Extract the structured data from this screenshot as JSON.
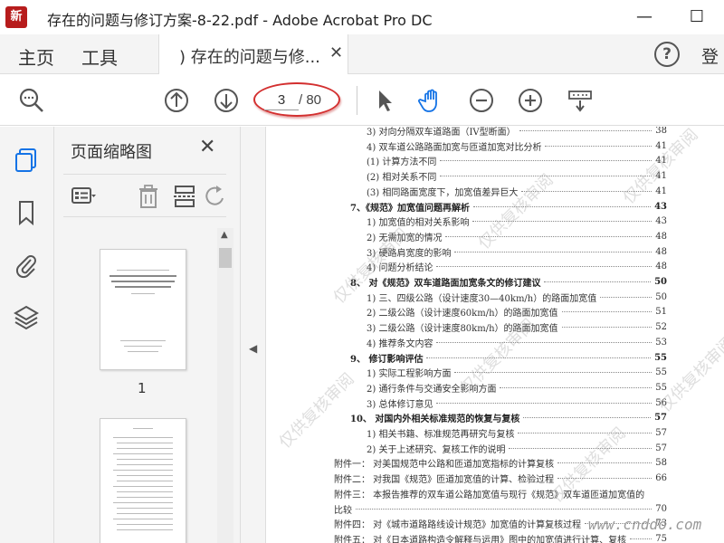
{
  "titlebar": {
    "window_title": "存在的问题与修订方案-8-22.pdf - Adobe Acrobat Pro DC",
    "logo_text": "新",
    "logo_overlay": "新",
    "minimize": "—",
    "maximize": "☐"
  },
  "tabs": {
    "home": "主页",
    "tools": "工具",
    "doc_tab": ") 存在的问题与修...",
    "doc_tab_close": "✕",
    "help": "?",
    "login": "登"
  },
  "toolbar": {
    "page_current": "3",
    "page_total": "/ 80"
  },
  "panel": {
    "title": "页面缩略图",
    "close": "✕",
    "thumb1_number": "1"
  },
  "toc": [
    {
      "text": "3) 对向分隔双车道路面（IV型断面）",
      "page": "38",
      "indent": 3,
      "bold": false
    },
    {
      "text": "4) 双车道公路路面加宽与匝道加宽对比分析",
      "page": "41",
      "indent": 3,
      "bold": false
    },
    {
      "text": "(1) 计算方法不同",
      "page": "41",
      "indent": 3,
      "bold": false
    },
    {
      "text": "(2) 相对关系不同",
      "page": "41",
      "indent": 3,
      "bold": false
    },
    {
      "text": "(3) 相同路面宽度下，加宽值差异巨大",
      "page": "41",
      "indent": 3,
      "bold": false
    },
    {
      "text": "7、《规范》加宽值问题再解析",
      "page": "43",
      "indent": 1,
      "bold": true
    },
    {
      "text": "1) 加宽值的相对关系影响",
      "page": "43",
      "indent": 3,
      "bold": false
    },
    {
      "text": "2) 无需加宽的情况",
      "page": "48",
      "indent": 3,
      "bold": false
    },
    {
      "text": "3) 硬路肩宽度的影响",
      "page": "48",
      "indent": 3,
      "bold": false
    },
    {
      "text": "4) 问题分析结论",
      "page": "48",
      "indent": 3,
      "bold": false
    },
    {
      "text": "8、 对《规范》双车道路面加宽条文的修订建议",
      "page": "50",
      "indent": 1,
      "bold": true
    },
    {
      "text": "1) 三、四级公路（设计速度30—40km/h）的路面加宽值",
      "page": "50",
      "indent": 3,
      "bold": false
    },
    {
      "text": "2) 二级公路（设计速度60km/h）的路面加宽值",
      "page": "51",
      "indent": 3,
      "bold": false
    },
    {
      "text": "3) 二级公路（设计速度80km/h）的路面加宽值",
      "page": "52",
      "indent": 3,
      "bold": false
    },
    {
      "text": "4) 推荐条文内容",
      "page": "53",
      "indent": 3,
      "bold": false
    },
    {
      "text": "9、 修订影响评估",
      "page": "55",
      "indent": 1,
      "bold": true
    },
    {
      "text": "1) 实际工程影响方面",
      "page": "55",
      "indent": 3,
      "bold": false
    },
    {
      "text": "2) 通行条件与交通安全影响方面",
      "page": "55",
      "indent": 3,
      "bold": false
    },
    {
      "text": "3) 总体修订意见",
      "page": "56",
      "indent": 3,
      "bold": false
    },
    {
      "text": "10、 对国内外相关标准规范的恢复与复核",
      "page": "57",
      "indent": 1,
      "bold": true
    },
    {
      "text": "1) 相关书籍、标准规范再研究与复核",
      "page": "57",
      "indent": 3,
      "bold": false
    },
    {
      "text": "2) 关于上述研究、复核工作的说明",
      "page": "57",
      "indent": 3,
      "bold": false
    },
    {
      "text": "附件一： 对美国规范中公路和匝道加宽指标的计算复核",
      "page": "58",
      "indent": 0,
      "bold": false
    },
    {
      "text": "附件二： 对我国《规范》匝道加宽值的计算、检验过程",
      "page": "66",
      "indent": 0,
      "bold": false
    },
    {
      "text": "附件三： 本报告推荐的双车道公路加宽值与现行《规范》双车道匝道加宽值的",
      "page": "",
      "indent": 0,
      "bold": false
    },
    {
      "text": "比较",
      "page": "70",
      "indent": 0,
      "bold": false
    },
    {
      "text": "附件四： 对《城市道路路线设计规范》加宽值的计算复核过程",
      "page": "73",
      "indent": 0,
      "bold": false
    },
    {
      "text": "附件五： 对《日本道路构造令解释与运用》图中的加宽值进行计算、复核",
      "page": "75",
      "indent": 0,
      "bold": false
    }
  ],
  "watermarks": [
    "仅供复核审阅",
    "仅供复核审阅",
    "仅供复核审阅",
    "仅供复核审阅",
    "仅供复核审阅",
    "仅供复核审阅",
    "仅供复核审阅"
  ],
  "site_watermark": "www.cnddo.com"
}
